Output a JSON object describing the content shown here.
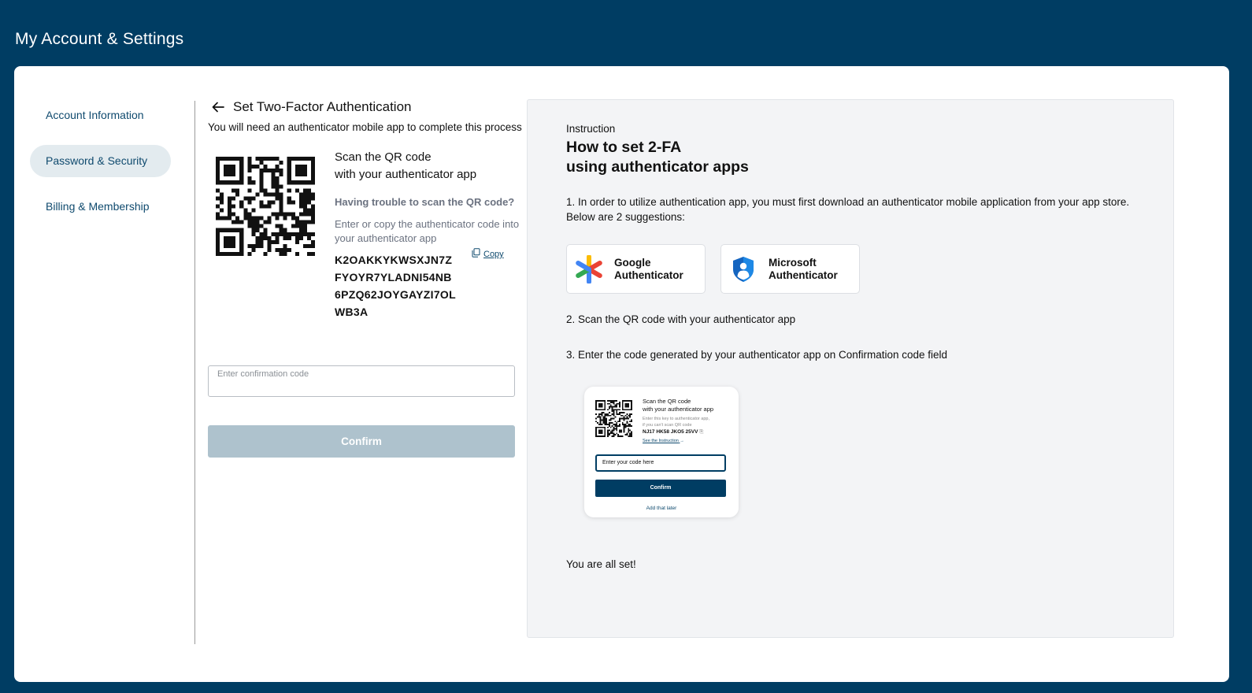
{
  "header": {
    "title": "My Account & Settings"
  },
  "sidebar": {
    "items": [
      {
        "label": "Account Information",
        "active": false
      },
      {
        "label": "Password & Security",
        "active": true
      },
      {
        "label": "Billing & Membership",
        "active": false
      }
    ]
  },
  "setup": {
    "title": "Set Two-Factor Authentication",
    "intro": "You will need an authenticator mobile app to complete this process",
    "scan_line1": "Scan the QR code",
    "scan_line2": "with your authenticator app",
    "trouble": "Having trouble to scan the QR code?",
    "enter_copy": "Enter or copy the authenticator code into your authenticator app",
    "copy_label": "Copy",
    "code_lines": [
      "K2OAKKYKWSXJN7Z",
      "FYOYR7YLADNI54NB",
      "6PZQ62JOYGAYZI7OL",
      "WB3A"
    ],
    "confirmation_placeholder": "Enter confirmation code",
    "confirm_label": "Confirm"
  },
  "instruction": {
    "label": "Instruction",
    "title_line1": "How to set 2-FA",
    "title_line2": "using authenticator apps",
    "step1": "1. In order to utilize authentication app, you must first download an authenticator mobile application from your app store. Below are 2 suggestions:",
    "apps": [
      {
        "line1": "Google",
        "line2": "Authenticator",
        "icon": "google-authenticator-icon"
      },
      {
        "line1": "Microsoft",
        "line2": "Authenticator",
        "icon": "microsoft-authenticator-icon"
      }
    ],
    "step2": "2. Scan the QR code with your authenticator app",
    "step3": "3. Enter the code generated by your authenticator app on Confirmation code field",
    "preview": {
      "scan_line1": "Scan the QR code",
      "scan_line2": "with your authenticator app",
      "enter_line1": "Enter this key to authenticator app,",
      "enter_line2": "if you can't scan QR code",
      "code": "NJ17 HK58 JKO5 25VV",
      "link": "See the Instruction",
      "input_value": "Enter your code here",
      "confirm": "Confirm",
      "later": "Add that later"
    },
    "done": "You are all set!"
  },
  "colors": {
    "brand": "#003d63",
    "nav_active_bg": "#e3ebef",
    "confirm_disabled": "#aec2cd",
    "panel_bg": "#f3f4f6"
  }
}
